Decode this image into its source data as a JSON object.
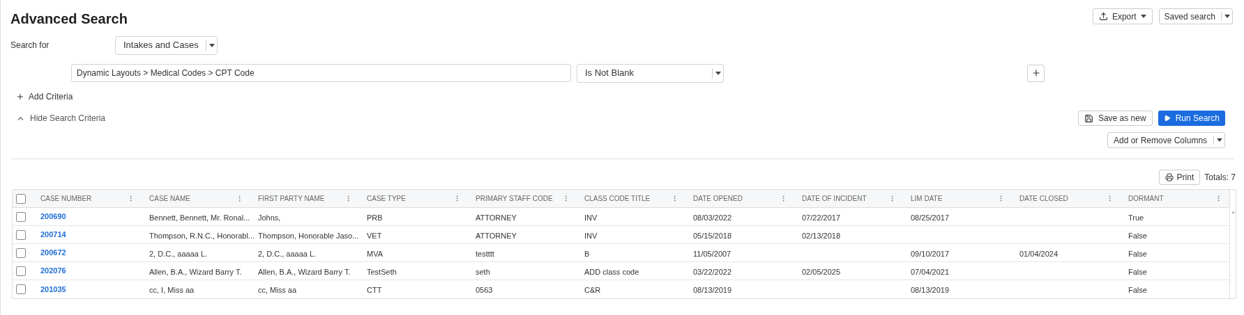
{
  "title": "Advanced Search",
  "header_buttons": [
    {
      "label": "Export",
      "kind": "export"
    },
    {
      "label": "Saved search",
      "kind": "split"
    }
  ],
  "search_for": {
    "label": "Search for",
    "value": "Intakes and Cases"
  },
  "criteria": [
    {
      "field": "Dynamic Layouts > Medical Codes > CPT Code",
      "operator": "Is Not Blank"
    }
  ],
  "add_criteria": "Add Criteria",
  "hide_criteria": "Hide Search Criteria",
  "actions": [
    {
      "label": "Save as new",
      "kind": "save"
    },
    {
      "label": "Run Search",
      "kind": "run"
    }
  ],
  "columns_dropdown": "Add or Remove Columns",
  "print": "Print",
  "totals": "Totals: 7",
  "table": {
    "all_checked": false,
    "columns": [
      "CASE NUMBER",
      "CASE NAME",
      "FIRST PARTY NAME",
      "CASE TYPE",
      "PRIMARY STAFF CODE",
      "CLASS CODE TITLE",
      "DATE OPENED",
      "DATE OF INCIDENT",
      "LIM DATE",
      "DATE CLOSED",
      "DORMANT"
    ],
    "rows": [
      {
        "checked": false,
        "cells": [
          "200690",
          "Bennett, Bennett, Mr. Ronal...",
          "Johns,",
          "PRB",
          "ATTORNEY",
          "INV",
          "08/03/2022",
          "07/22/2017",
          "08/25/2017",
          "",
          "True"
        ]
      },
      {
        "checked": false,
        "cells": [
          "200714",
          "Thompson, R.N.C., Honorabl...",
          "Thompson, Honorable Jaso...",
          "VET",
          "ATTORNEY",
          "INV",
          "05/15/2018",
          "02/13/2018",
          "",
          "",
          "False"
        ]
      },
      {
        "checked": false,
        "cells": [
          "200672",
          "2, D.C., aaaaa L.",
          "2, D.C., aaaaa L.",
          "MVA",
          "testttt",
          "B",
          "11/05/2007",
          "",
          "09/10/2017",
          "01/04/2024",
          "False"
        ]
      },
      {
        "checked": false,
        "cells": [
          "202076",
          "Allen, B.A., Wizard Barry T.",
          "Allen, B.A., Wizard Barry T.",
          "TestSeth",
          "seth",
          "ADD class code",
          "03/22/2022",
          "02/05/2025",
          "07/04/2021",
          "",
          "False"
        ]
      },
      {
        "checked": false,
        "cells": [
          "201035",
          "cc, I, Miss aa",
          "cc, Miss aa",
          "CTT",
          "0563",
          "C&R",
          "08/13/2019",
          "",
          "08/13/2019",
          "",
          "False"
        ]
      }
    ]
  }
}
